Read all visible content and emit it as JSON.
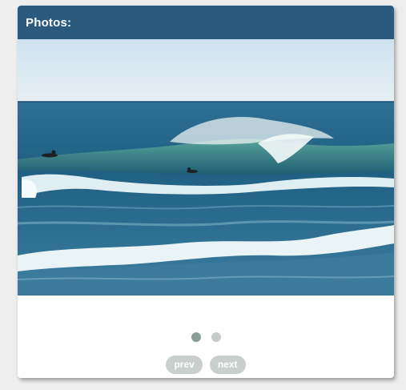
{
  "widget": {
    "title": "Photos:",
    "photo": {
      "subject": "ocean wave breaking with surfers",
      "index": 1,
      "count": 2
    },
    "pager": {
      "dots": [
        {
          "active": true
        },
        {
          "active": false
        }
      ]
    },
    "nav": {
      "prev_label": "prev",
      "next_label": "next"
    }
  },
  "colors": {
    "header": "#2b5a7e",
    "dot_active": "#8a9c96",
    "dot_inactive": "#c4cbc8",
    "button": "#c8cfcc"
  }
}
